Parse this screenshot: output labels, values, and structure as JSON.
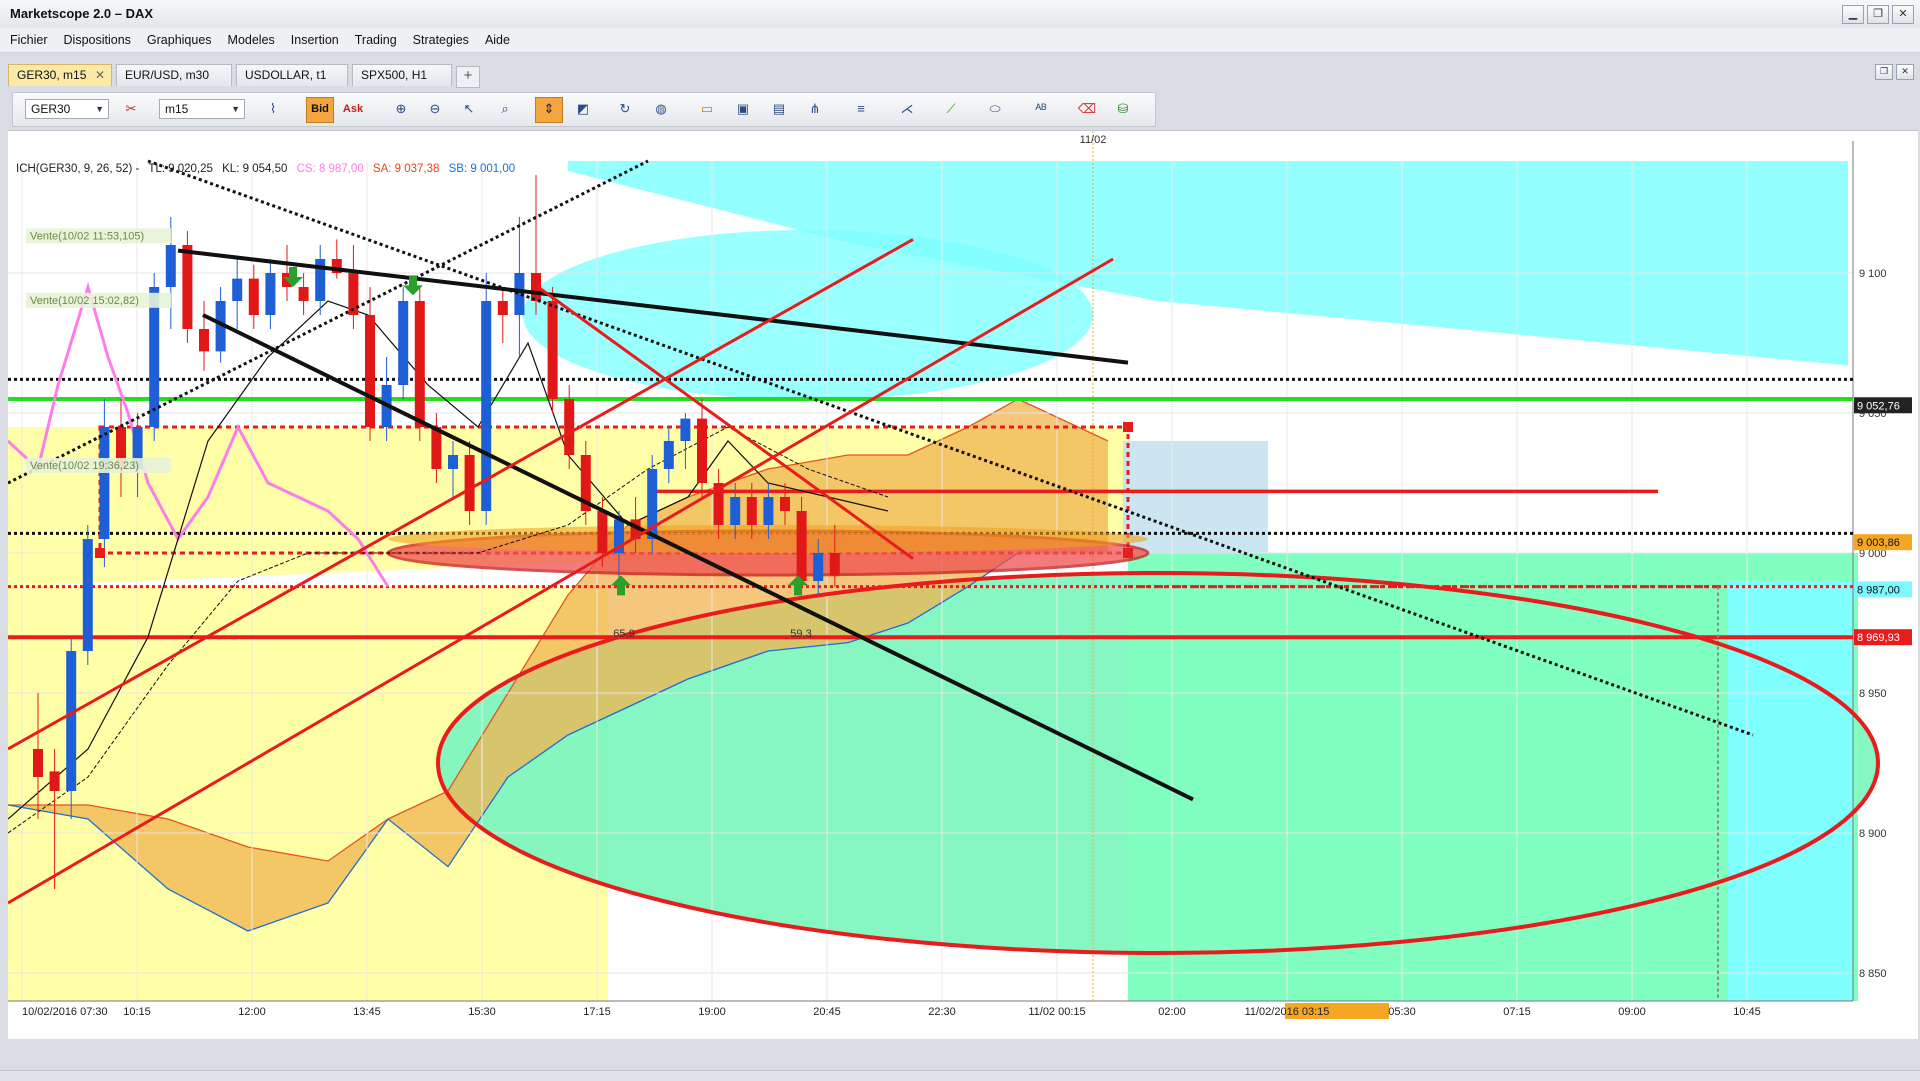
{
  "window": {
    "title": "Marketscope 2.0 – DAX",
    "minimize": "▁",
    "restore": "❐",
    "close": "✕"
  },
  "menu": [
    "Fichier",
    "Dispositions",
    "Graphiques",
    "Modeles",
    "Insertion",
    "Trading",
    "Strategies",
    "Aide"
  ],
  "tabs": [
    {
      "label": "GER30, m15",
      "active": true
    },
    {
      "label": "EUR/USD, m30",
      "active": false
    },
    {
      "label": "USDOLLAR, t1",
      "active": false
    },
    {
      "label": "SPX500, H1",
      "active": false
    }
  ],
  "tab_add": "+",
  "tab_close": "✕",
  "toolbar": {
    "instrument": "GER30",
    "timeframe": "m15",
    "bid": "Bid",
    "ask": "Ask"
  },
  "chart_legend": {
    "ich": "ICH(GER30, 9, 26, 52) -",
    "tl": "TL: 9 020,25",
    "kl": "KL: 9 054,50",
    "cs": "CS: 8 987,00",
    "sa": "SA: 9 037,38",
    "sb": "SB: 9 001,00"
  },
  "chart_data": {
    "type": "candlestick",
    "instrument": "GER30",
    "timeframe": "m15",
    "indicator": "ICH(GER30, 9, 26, 52)",
    "x_tick_labels": [
      "10/02/2016 07:30",
      "10:15",
      "12:00",
      "13:45",
      "15:30",
      "17:15",
      "19:00",
      "20:45",
      "22:30",
      "11/02 00:15",
      "02:00",
      "11/02/2016 03:15",
      "05:30",
      "07:15",
      "09:00",
      "10:45"
    ],
    "y_tick_labels": [
      "9 100",
      "9 050",
      "9 000",
      "8 950",
      "8 900",
      "8 850"
    ],
    "ylim": [
      8840,
      9140
    ],
    "top_marker": "11/02",
    "price_tags": [
      {
        "value": "9 052,76",
        "color": "#222222",
        "text_color": "#ffffff"
      },
      {
        "value": "9 003,86",
        "color": "#f5a623",
        "text_color": "#111111"
      },
      {
        "value": "8 987,00",
        "color": "#7ff7ff",
        "text_color": "#111111"
      },
      {
        "value": "8 969,93",
        "color": "#e81c1c",
        "text_color": "#ffffff"
      }
    ],
    "order_labels": [
      "Vente(10/02 11:53,105)",
      "Vente(10/02 15:02,82)",
      "Vente(10/02 19:36,23)"
    ],
    "arrow_labels": [
      "65,9",
      "59,3"
    ],
    "horizontal_levels": [
      {
        "value": 9055,
        "color": "#22dd22",
        "style": "solid"
      },
      {
        "value": 9062,
        "color": "#111111",
        "style": "dotted"
      },
      {
        "value": 9007,
        "color": "#111111",
        "style": "dotted"
      },
      {
        "value": 8969.93,
        "color": "#e81c1c",
        "style": "solid"
      },
      {
        "value": 8988,
        "color": "#e81c1c",
        "style": "dotted"
      }
    ],
    "candles": [
      {
        "o": 8930,
        "h": 8950,
        "l": 8905,
        "c": 8920,
        "dir": "down"
      },
      {
        "o": 8922,
        "h": 8930,
        "l": 8880,
        "c": 8915,
        "dir": "down"
      },
      {
        "o": 8915,
        "h": 8970,
        "l": 8905,
        "c": 8965,
        "dir": "up"
      },
      {
        "o": 8965,
        "h": 9010,
        "l": 8960,
        "c": 9005,
        "dir": "up"
      },
      {
        "o": 9005,
        "h": 9055,
        "l": 8995,
        "c": 9045,
        "dir": "up"
      },
      {
        "o": 9045,
        "h": 9055,
        "l": 9020,
        "c": 9030,
        "dir": "down"
      },
      {
        "o": 9030,
        "h": 9050,
        "l": 9020,
        "c": 9045,
        "dir": "up"
      },
      {
        "o": 9045,
        "h": 9100,
        "l": 9040,
        "c": 9095,
        "dir": "up"
      },
      {
        "o": 9095,
        "h": 9120,
        "l": 9080,
        "c": 9110,
        "dir": "up"
      },
      {
        "o": 9110,
        "h": 9115,
        "l": 9075,
        "c": 9080,
        "dir": "down"
      },
      {
        "o": 9080,
        "h": 9090,
        "l": 9065,
        "c": 9072,
        "dir": "down"
      },
      {
        "o": 9072,
        "h": 9095,
        "l": 9068,
        "c": 9090,
        "dir": "up"
      },
      {
        "o": 9090,
        "h": 9105,
        "l": 9080,
        "c": 9098,
        "dir": "up"
      },
      {
        "o": 9098,
        "h": 9103,
        "l": 9080,
        "c": 9085,
        "dir": "down"
      },
      {
        "o": 9085,
        "h": 9105,
        "l": 9080,
        "c": 9100,
        "dir": "up"
      },
      {
        "o": 9100,
        "h": 9110,
        "l": 9090,
        "c": 9095,
        "dir": "down"
      },
      {
        "o": 9095,
        "h": 9100,
        "l": 9085,
        "c": 9090,
        "dir": "down"
      },
      {
        "o": 9090,
        "h": 9110,
        "l": 9085,
        "c": 9105,
        "dir": "up"
      },
      {
        "o": 9105,
        "h": 9112,
        "l": 9098,
        "c": 9100,
        "dir": "down"
      },
      {
        "o": 9100,
        "h": 9110,
        "l": 9080,
        "c": 9085,
        "dir": "down"
      },
      {
        "o": 9085,
        "h": 9095,
        "l": 9040,
        "c": 9045,
        "dir": "down"
      },
      {
        "o": 9045,
        "h": 9070,
        "l": 9040,
        "c": 9060,
        "dir": "up"
      },
      {
        "o": 9060,
        "h": 9095,
        "l": 9055,
        "c": 9090,
        "dir": "up"
      },
      {
        "o": 9090,
        "h": 9095,
        "l": 9040,
        "c": 9045,
        "dir": "down"
      },
      {
        "o": 9045,
        "h": 9050,
        "l": 9025,
        "c": 9030,
        "dir": "down"
      },
      {
        "o": 9030,
        "h": 9040,
        "l": 9020,
        "c": 9035,
        "dir": "up"
      },
      {
        "o": 9035,
        "h": 9040,
        "l": 9010,
        "c": 9015,
        "dir": "down"
      },
      {
        "o": 9015,
        "h": 9100,
        "l": 9010,
        "c": 9090,
        "dir": "up"
      },
      {
        "o": 9090,
        "h": 9095,
        "l": 9075,
        "c": 9085,
        "dir": "down"
      },
      {
        "o": 9085,
        "h": 9120,
        "l": 9070,
        "c": 9100,
        "dir": "up"
      },
      {
        "o": 9100,
        "h": 9135,
        "l": 9085,
        "c": 9090,
        "dir": "down"
      },
      {
        "o": 9090,
        "h": 9095,
        "l": 9050,
        "c": 9055,
        "dir": "down"
      },
      {
        "o": 9055,
        "h": 9060,
        "l": 9030,
        "c": 9035,
        "dir": "down"
      },
      {
        "o": 9035,
        "h": 9040,
        "l": 9010,
        "c": 9015,
        "dir": "down"
      },
      {
        "o": 9015,
        "h": 9020,
        "l": 8995,
        "c": 9000,
        "dir": "down"
      },
      {
        "o": 9000,
        "h": 9015,
        "l": 8990,
        "c": 9012,
        "dir": "up"
      },
      {
        "o": 9012,
        "h": 9020,
        "l": 9000,
        "c": 9005,
        "dir": "down"
      },
      {
        "o": 9005,
        "h": 9035,
        "l": 9000,
        "c": 9030,
        "dir": "up"
      },
      {
        "o": 9030,
        "h": 9045,
        "l": 9025,
        "c": 9040,
        "dir": "up"
      },
      {
        "o": 9040,
        "h": 9050,
        "l": 9030,
        "c": 9048,
        "dir": "up"
      },
      {
        "o": 9048,
        "h": 9055,
        "l": 9020,
        "c": 9025,
        "dir": "down"
      },
      {
        "o": 9025,
        "h": 9030,
        "l": 9005,
        "c": 9010,
        "dir": "down"
      },
      {
        "o": 9010,
        "h": 9025,
        "l": 9005,
        "c": 9020,
        "dir": "up"
      },
      {
        "o": 9020,
        "h": 9025,
        "l": 9005,
        "c": 9010,
        "dir": "down"
      },
      {
        "o": 9010,
        "h": 9025,
        "l": 9005,
        "c": 9020,
        "dir": "up"
      },
      {
        "o": 9020,
        "h": 9025,
        "l": 9010,
        "c": 9015,
        "dir": "down"
      },
      {
        "o": 9015,
        "h": 9020,
        "l": 8985,
        "c": 8990,
        "dir": "down"
      },
      {
        "o": 8990,
        "h": 9005,
        "l": 8985,
        "c": 9000,
        "dir": "up"
      },
      {
        "o": 9000,
        "h": 9010,
        "l": 8988,
        "c": 8992,
        "dir": "down"
      }
    ]
  }
}
